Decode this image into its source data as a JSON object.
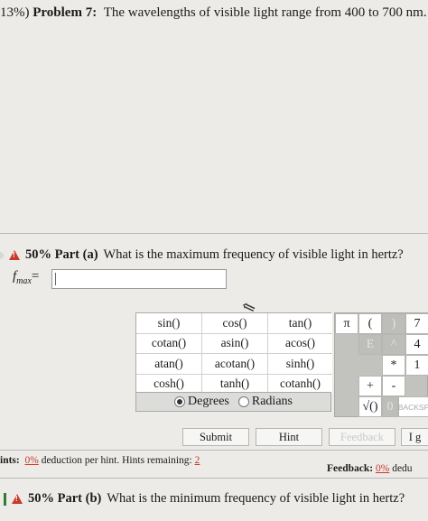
{
  "problem": {
    "weight": "13%)",
    "number_label": "Problem 7:",
    "text": "The wavelengths of visible light range from 400 to 700 nm."
  },
  "part_a": {
    "label": "50% Part (a)",
    "question": "What is the maximum frequency of visible light in hertz?",
    "variable": "f",
    "subscript": "max",
    "equals": "=",
    "answer_value": ""
  },
  "functions": [
    "sin()",
    "cos()",
    "tan()",
    "cotan()",
    "asin()",
    "acos()",
    "atan()",
    "acotan()",
    "sinh()",
    "cosh()",
    "tanh()",
    "cotanh()"
  ],
  "angle_mode": {
    "degrees": "Degrees",
    "radians": "Radians",
    "selected": "Degrees"
  },
  "keypad": {
    "pi": "π",
    "lparen": "(",
    "rparen": ")",
    "seven": "7",
    "four": "4",
    "mult": "*",
    "one": "1",
    "plus": "+",
    "minus": "-",
    "sqrt": "√()",
    "zero": "0",
    "backspace": "BACKSP",
    "e_key": "E",
    "pow_key": "^",
    "ln_key": ""
  },
  "buttons": {
    "submit": "Submit",
    "hint": "Hint",
    "feedback": "Feedback",
    "give_up": "I g"
  },
  "hints": {
    "prefix": "ints:",
    "pct": "0%",
    "middle": "deduction per hint. Hints remaining:",
    "remaining": "2"
  },
  "feedback": {
    "label": "Feedback:",
    "pct": "0%",
    "suffix": "dedu"
  },
  "part_b": {
    "label": "50% Part (b)",
    "question": "What is the minimum frequency of visible light in hertz?"
  }
}
